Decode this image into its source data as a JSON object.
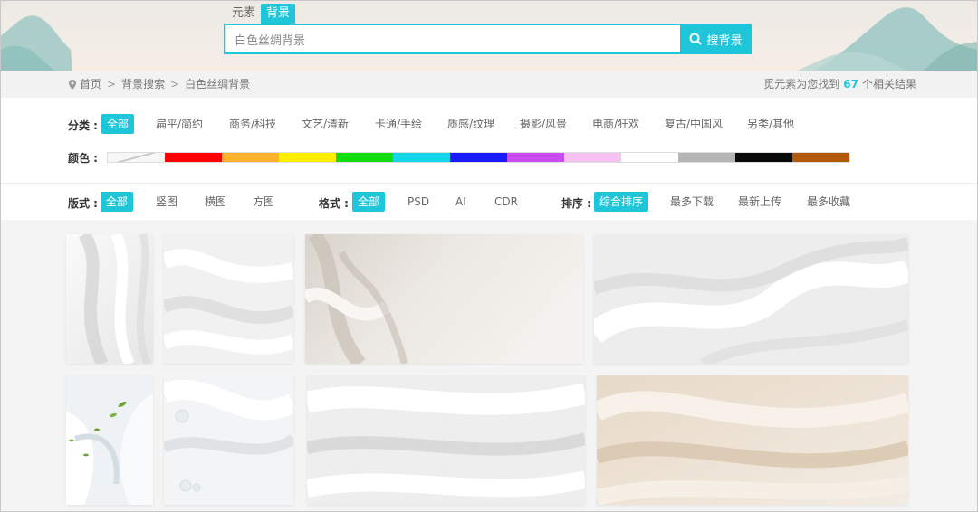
{
  "search": {
    "tabs": [
      "元素",
      "背景"
    ],
    "active_tab": 1,
    "value": "白色丝绸背景",
    "button_label": "搜背景"
  },
  "breadcrumb": {
    "home": "首页",
    "level1": "背景搜索",
    "current": "白色丝绸背景",
    "separator": ">"
  },
  "results": {
    "prefix": "觅元素为您找到",
    "count": "67",
    "suffix": "个相关结果"
  },
  "filters": {
    "category_label": "分类 :",
    "categories": [
      "全部",
      "扁平/简约",
      "商务/科技",
      "文艺/清新",
      "卡通/手绘",
      "质感/纹理",
      "摄影/风景",
      "电商/狂欢",
      "复古/中国风",
      "另类/其他"
    ],
    "color_label": "颜色 :",
    "colors": [
      "none",
      "#ff0000",
      "#ffb22c",
      "#ffee00",
      "#11dd11",
      "#11d6e8",
      "#1a1aff",
      "#c94cf0",
      "#f6c2f2",
      "#ffffff",
      "#b5b5b5",
      "#0a0a0a",
      "#b35a0a"
    ],
    "layout_label": "版式 :",
    "layouts": [
      "全部",
      "竖图",
      "横图",
      "方图"
    ],
    "format_label": "格式 :",
    "formats": [
      "全部",
      "PSD",
      "AI",
      "CDR"
    ],
    "sort_label": "排序 :",
    "sorts": [
      "综合排序",
      "最多下载",
      "最新上传",
      "最多收藏"
    ]
  },
  "accent_color": "#1fc6d9",
  "gallery": {
    "items": [
      {
        "name": "silk-thumb-1",
        "tone": "white"
      },
      {
        "name": "silk-thumb-2",
        "tone": "white"
      },
      {
        "name": "silk-thumb-3",
        "tone": "beige"
      },
      {
        "name": "silk-thumb-4",
        "tone": "white"
      },
      {
        "name": "silk-thumb-5",
        "tone": "lily"
      },
      {
        "name": "silk-thumb-6",
        "tone": "pearl"
      },
      {
        "name": "silk-thumb-7",
        "tone": "white"
      },
      {
        "name": "silk-thumb-8",
        "tone": "champagne"
      }
    ]
  }
}
